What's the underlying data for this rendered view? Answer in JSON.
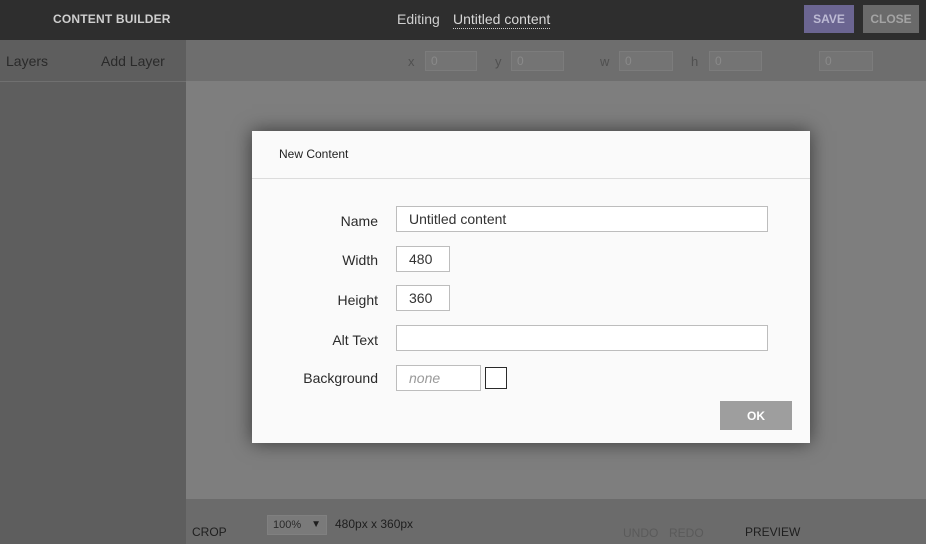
{
  "topbar": {
    "app_title": "CONTENT BUILDER",
    "editing_label": "Editing",
    "doc_name": "Untitled content",
    "save_label": "SAVE",
    "close_label": "CLOSE"
  },
  "left_panel": {
    "tabs": [
      {
        "label": "Layers"
      },
      {
        "label": "Add Layer"
      }
    ]
  },
  "toolbar": {
    "x_label": "x",
    "x_value": "0",
    "y_label": "y",
    "y_value": "0",
    "w_label": "w",
    "w_value": "0",
    "h_label": "h",
    "h_value": "0",
    "rotation_value": "0"
  },
  "bottombar": {
    "crop_label": "CROP",
    "zoom_value": "100%",
    "zoom_arrow": "▼",
    "size_label": "480px x 360px",
    "undo_label": "UNDO",
    "redo_label": "REDO",
    "preview_label": "PREVIEW"
  },
  "modal": {
    "title": "New Content",
    "name_label": "Name",
    "name_value": "Untitled content",
    "width_label": "Width",
    "width_value": "480",
    "height_label": "Height",
    "height_value": "360",
    "alt_label": "Alt Text",
    "alt_value": "",
    "background_label": "Background",
    "background_placeholder": "none",
    "ok_label": "OK"
  },
  "colors": {
    "topbar_bg": "#2e2e2e",
    "save_bg": "#6b6591",
    "ok_bg": "#9e9e9e",
    "swatch_border": "#2a2a2a"
  }
}
